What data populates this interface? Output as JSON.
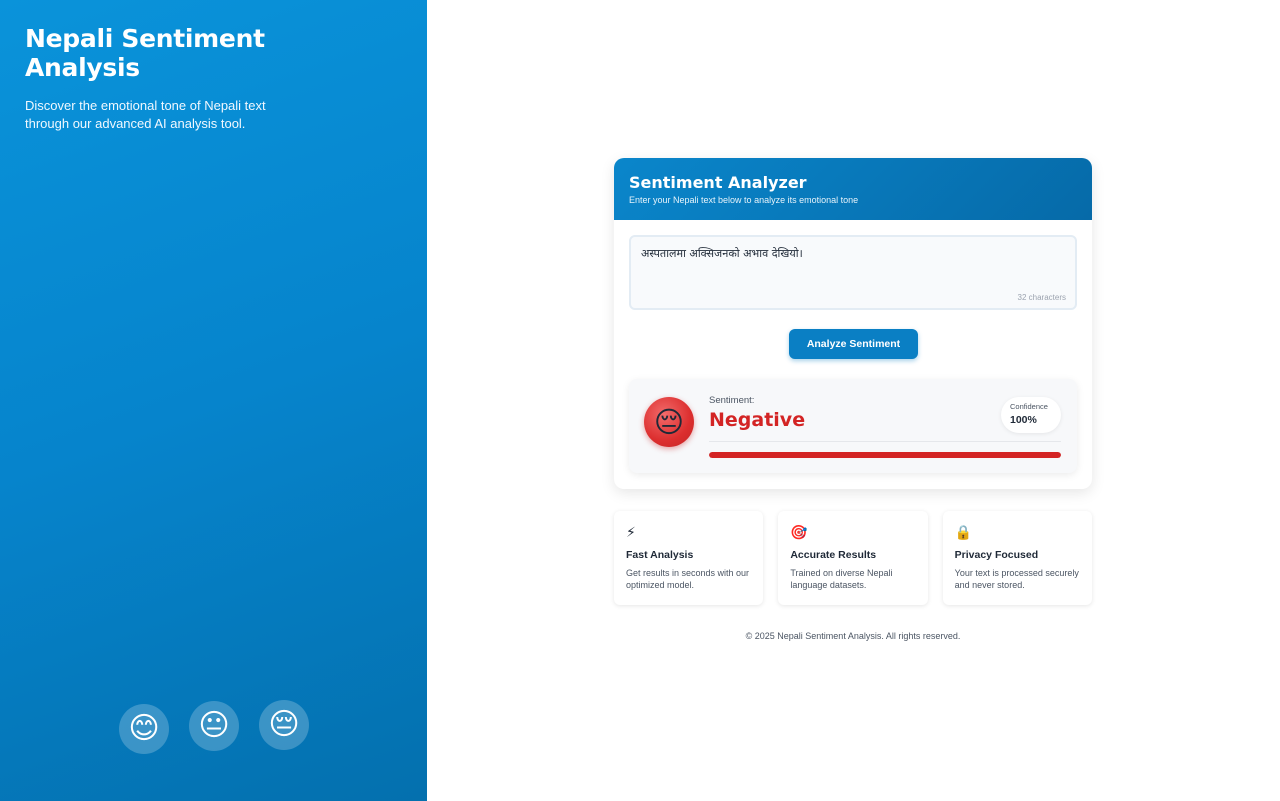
{
  "sidebar": {
    "title": "Nepali Sentiment Analysis",
    "description": "Discover the emotional tone of Nepali text through our advanced AI analysis tool.",
    "emojis": [
      "😊",
      "😐",
      "😔"
    ]
  },
  "analyzer": {
    "title": "Sentiment Analyzer",
    "subtitle": "Enter your Nepali text below to analyze its emotional tone",
    "input_value": "अस्पतालमा अक्सिजनको अभाव देखियो।",
    "char_count": "32 characters",
    "button_label": "Analyze Sentiment"
  },
  "result": {
    "emoji": "😔",
    "label": "Sentiment:",
    "value": "Negative",
    "confidence_label": "Confidence",
    "confidence_value": "100%",
    "confidence_fraction": 1.0,
    "color": "#d32424"
  },
  "features": [
    {
      "icon": "⚡",
      "icon_name": "lightning-icon",
      "title": "Fast Analysis",
      "description": "Get results in seconds with our optimized model."
    },
    {
      "icon": "🎯",
      "icon_name": "target-icon",
      "title": "Accurate Results",
      "description": "Trained on diverse Nepali language datasets."
    },
    {
      "icon": "🔒",
      "icon_name": "lock-icon",
      "title": "Privacy Focused",
      "description": "Your text is processed securely and never stored."
    }
  ],
  "footer": "© 2025 Nepali Sentiment Analysis. All rights reserved.",
  "colors": {
    "brand": "#0a7fc4",
    "negative": "#d32424"
  }
}
